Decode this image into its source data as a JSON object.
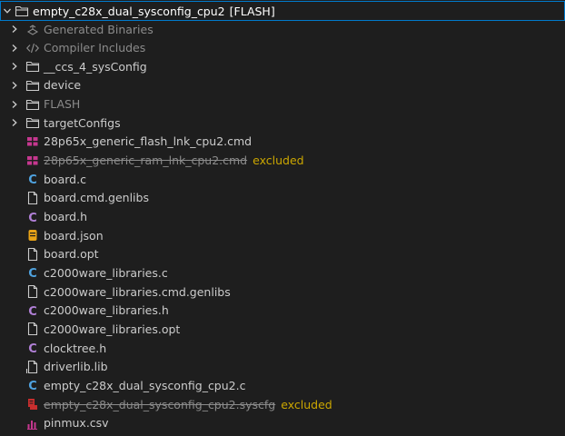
{
  "colors": {
    "c_source": "#4fa3e0",
    "c_header": "#b180d7",
    "json": "#e8a317",
    "cmd": "#c5378f",
    "syscfg": "#c72e2e",
    "csv": "#c5378f",
    "excluded": "#cca700",
    "focus": "#007acc"
  },
  "root": {
    "label": "empty_c28x_dual_sysconfig_cpu2",
    "config": "[FLASH]",
    "icon": "project-folder-icon"
  },
  "items": [
    {
      "label": "Generated Binaries",
      "icon": "binaries-icon",
      "expandable": true,
      "dim": true
    },
    {
      "label": "Compiler Includes",
      "icon": "code-icon",
      "expandable": true,
      "dim": true
    },
    {
      "label": "__ccs_4_sysConfig",
      "icon": "folder-icon",
      "expandable": true
    },
    {
      "label": "device",
      "icon": "folder-icon",
      "expandable": true
    },
    {
      "label": "FLASH",
      "icon": "folder-icon",
      "expandable": true,
      "dim": true
    },
    {
      "label": "targetConfigs",
      "icon": "folder-icon",
      "expandable": true
    },
    {
      "label": "28p65x_generic_flash_lnk_cpu2.cmd",
      "icon": "cmd-icon"
    },
    {
      "label": "28p65x_generic_ram_lnk_cpu2.cmd",
      "icon": "cmd-icon",
      "struck": true,
      "tag": "excluded"
    },
    {
      "label": "board.c",
      "icon": "c-source-icon"
    },
    {
      "label": "board.cmd.genlibs",
      "icon": "file-icon"
    },
    {
      "label": "board.h",
      "icon": "c-header-icon"
    },
    {
      "label": "board.json",
      "icon": "json-icon"
    },
    {
      "label": "board.opt",
      "icon": "file-icon"
    },
    {
      "label": "c2000ware_libraries.c",
      "icon": "c-source-icon"
    },
    {
      "label": "c2000ware_libraries.cmd.genlibs",
      "icon": "file-icon"
    },
    {
      "label": "c2000ware_libraries.h",
      "icon": "c-header-icon"
    },
    {
      "label": "c2000ware_libraries.opt",
      "icon": "file-icon"
    },
    {
      "label": "clocktree.h",
      "icon": "c-header-icon"
    },
    {
      "label": "driverlib.lib",
      "icon": "library-icon"
    },
    {
      "label": "empty_c28x_dual_sysconfig_cpu2.c",
      "icon": "c-source-icon"
    },
    {
      "label": "empty_c28x_dual_sysconfig_cpu2.syscfg",
      "icon": "syscfg-icon",
      "struck": true,
      "tag": "excluded"
    },
    {
      "label": "pinmux.csv",
      "icon": "csv-icon"
    }
  ]
}
